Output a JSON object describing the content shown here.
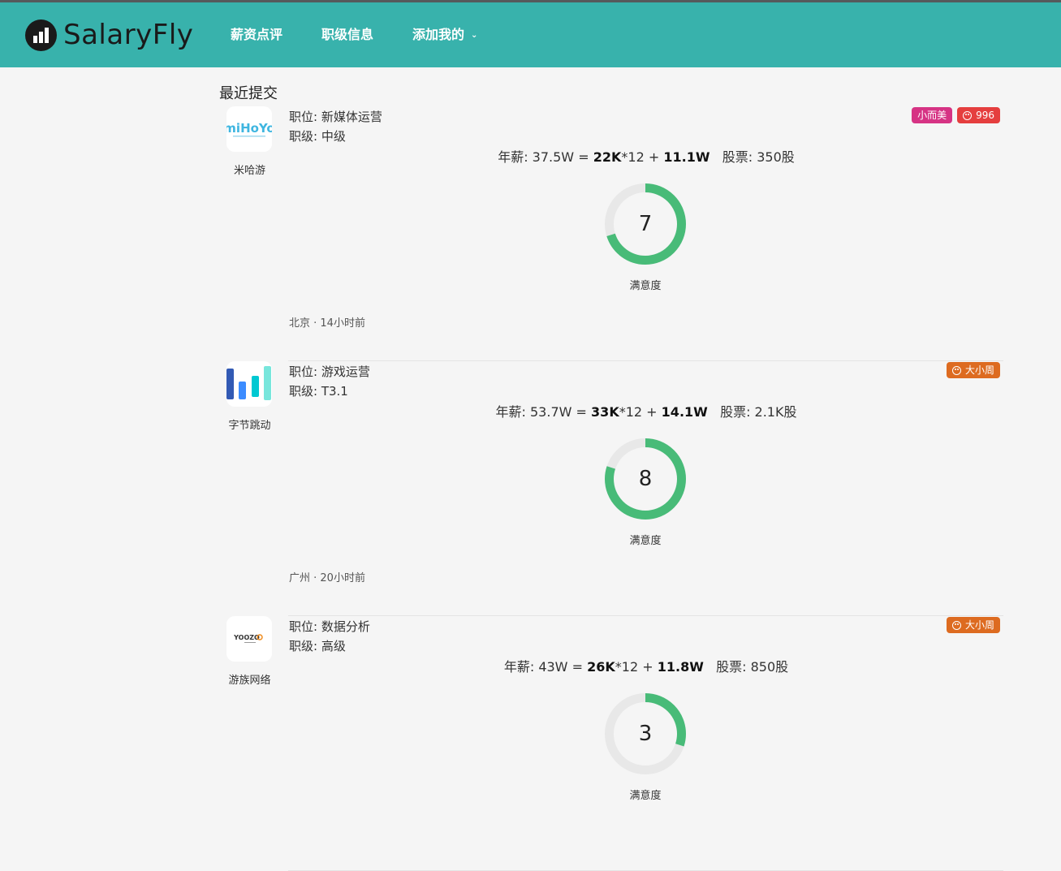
{
  "navbar": {
    "brand": "SalaryFly",
    "items": [
      {
        "label": "薪资点评"
      },
      {
        "label": "职级信息"
      },
      {
        "label": "添加我的"
      }
    ],
    "bg_color": "#38b2ac"
  },
  "section_title": "最近提交",
  "posts": [
    {
      "company": "米哈游",
      "logo": "miHoYo",
      "position": "职位: 新媒体运营",
      "level": "职级: 中级",
      "salary": {
        "annual": "年薪: 37.5W",
        "eq": "=",
        "monthly": "22K",
        "months": "*12",
        "plus": "+",
        "bonus": "11.1W",
        "stock": "股票: 350股"
      },
      "satisfaction": 7,
      "satisfaction_fraction": 0.7,
      "satisfaction_label": "满意度",
      "meta": "北京 · 14小时前",
      "tags": [
        {
          "label": "小而美",
          "color": "#d63384",
          "icon": false
        },
        {
          "label": "996",
          "color": "#e53e3e",
          "icon": true
        }
      ]
    },
    {
      "company": "字节跳动",
      "logo": "bytedance",
      "position": "职位: 游戏运营",
      "level": "职级: T3.1",
      "salary": {
        "annual": "年薪: 53.7W",
        "eq": "=",
        "monthly": "33K",
        "months": "*12",
        "plus": "+",
        "bonus": "14.1W",
        "stock": "股票: 2.1K股"
      },
      "satisfaction": 8,
      "satisfaction_fraction": 0.8,
      "satisfaction_label": "满意度",
      "meta": "广州 · 20小时前",
      "tags": [
        {
          "label": "大小周",
          "color": "#dd6b20",
          "icon": true
        }
      ]
    },
    {
      "company": "游族网络",
      "logo": "YOOZOO",
      "position": "职位: 数据分析",
      "level": "职级: 高级",
      "salary": {
        "annual": "年薪: 43W",
        "eq": "=",
        "monthly": "26K",
        "months": "*12",
        "plus": "+",
        "bonus": "11.8W",
        "stock": "股票: 850股"
      },
      "satisfaction": 3,
      "satisfaction_fraction": 0.3,
      "satisfaction_label": "满意度",
      "meta": "",
      "tags": [
        {
          "label": "大小周",
          "color": "#dd6b20",
          "icon": true
        }
      ]
    }
  ],
  "gauge_color": "#48bb78",
  "gauge_track": "#e8e8e8"
}
